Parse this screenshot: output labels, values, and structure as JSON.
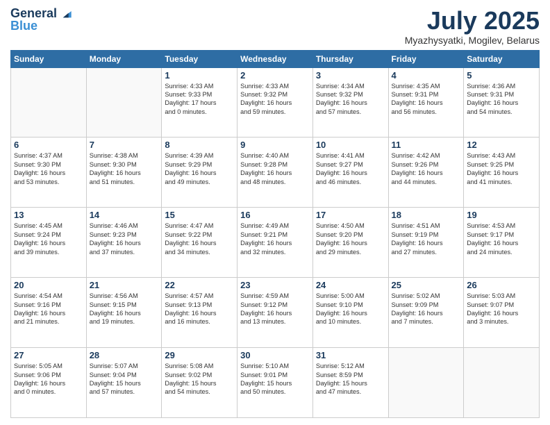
{
  "header": {
    "logo_line1": "General",
    "logo_line2": "Blue",
    "main_title": "July 2025",
    "subtitle": "Myazhysyatki, Mogilev, Belarus"
  },
  "days_of_week": [
    "Sunday",
    "Monday",
    "Tuesday",
    "Wednesday",
    "Thursday",
    "Friday",
    "Saturday"
  ],
  "weeks": [
    [
      {
        "day": "",
        "text": ""
      },
      {
        "day": "",
        "text": ""
      },
      {
        "day": "1",
        "text": "Sunrise: 4:33 AM\nSunset: 9:33 PM\nDaylight: 17 hours\nand 0 minutes."
      },
      {
        "day": "2",
        "text": "Sunrise: 4:33 AM\nSunset: 9:32 PM\nDaylight: 16 hours\nand 59 minutes."
      },
      {
        "day": "3",
        "text": "Sunrise: 4:34 AM\nSunset: 9:32 PM\nDaylight: 16 hours\nand 57 minutes."
      },
      {
        "day": "4",
        "text": "Sunrise: 4:35 AM\nSunset: 9:31 PM\nDaylight: 16 hours\nand 56 minutes."
      },
      {
        "day": "5",
        "text": "Sunrise: 4:36 AM\nSunset: 9:31 PM\nDaylight: 16 hours\nand 54 minutes."
      }
    ],
    [
      {
        "day": "6",
        "text": "Sunrise: 4:37 AM\nSunset: 9:30 PM\nDaylight: 16 hours\nand 53 minutes."
      },
      {
        "day": "7",
        "text": "Sunrise: 4:38 AM\nSunset: 9:30 PM\nDaylight: 16 hours\nand 51 minutes."
      },
      {
        "day": "8",
        "text": "Sunrise: 4:39 AM\nSunset: 9:29 PM\nDaylight: 16 hours\nand 49 minutes."
      },
      {
        "day": "9",
        "text": "Sunrise: 4:40 AM\nSunset: 9:28 PM\nDaylight: 16 hours\nand 48 minutes."
      },
      {
        "day": "10",
        "text": "Sunrise: 4:41 AM\nSunset: 9:27 PM\nDaylight: 16 hours\nand 46 minutes."
      },
      {
        "day": "11",
        "text": "Sunrise: 4:42 AM\nSunset: 9:26 PM\nDaylight: 16 hours\nand 44 minutes."
      },
      {
        "day": "12",
        "text": "Sunrise: 4:43 AM\nSunset: 9:25 PM\nDaylight: 16 hours\nand 41 minutes."
      }
    ],
    [
      {
        "day": "13",
        "text": "Sunrise: 4:45 AM\nSunset: 9:24 PM\nDaylight: 16 hours\nand 39 minutes."
      },
      {
        "day": "14",
        "text": "Sunrise: 4:46 AM\nSunset: 9:23 PM\nDaylight: 16 hours\nand 37 minutes."
      },
      {
        "day": "15",
        "text": "Sunrise: 4:47 AM\nSunset: 9:22 PM\nDaylight: 16 hours\nand 34 minutes."
      },
      {
        "day": "16",
        "text": "Sunrise: 4:49 AM\nSunset: 9:21 PM\nDaylight: 16 hours\nand 32 minutes."
      },
      {
        "day": "17",
        "text": "Sunrise: 4:50 AM\nSunset: 9:20 PM\nDaylight: 16 hours\nand 29 minutes."
      },
      {
        "day": "18",
        "text": "Sunrise: 4:51 AM\nSunset: 9:19 PM\nDaylight: 16 hours\nand 27 minutes."
      },
      {
        "day": "19",
        "text": "Sunrise: 4:53 AM\nSunset: 9:17 PM\nDaylight: 16 hours\nand 24 minutes."
      }
    ],
    [
      {
        "day": "20",
        "text": "Sunrise: 4:54 AM\nSunset: 9:16 PM\nDaylight: 16 hours\nand 21 minutes."
      },
      {
        "day": "21",
        "text": "Sunrise: 4:56 AM\nSunset: 9:15 PM\nDaylight: 16 hours\nand 19 minutes."
      },
      {
        "day": "22",
        "text": "Sunrise: 4:57 AM\nSunset: 9:13 PM\nDaylight: 16 hours\nand 16 minutes."
      },
      {
        "day": "23",
        "text": "Sunrise: 4:59 AM\nSunset: 9:12 PM\nDaylight: 16 hours\nand 13 minutes."
      },
      {
        "day": "24",
        "text": "Sunrise: 5:00 AM\nSunset: 9:10 PM\nDaylight: 16 hours\nand 10 minutes."
      },
      {
        "day": "25",
        "text": "Sunrise: 5:02 AM\nSunset: 9:09 PM\nDaylight: 16 hours\nand 7 minutes."
      },
      {
        "day": "26",
        "text": "Sunrise: 5:03 AM\nSunset: 9:07 PM\nDaylight: 16 hours\nand 3 minutes."
      }
    ],
    [
      {
        "day": "27",
        "text": "Sunrise: 5:05 AM\nSunset: 9:06 PM\nDaylight: 16 hours\nand 0 minutes."
      },
      {
        "day": "28",
        "text": "Sunrise: 5:07 AM\nSunset: 9:04 PM\nDaylight: 15 hours\nand 57 minutes."
      },
      {
        "day": "29",
        "text": "Sunrise: 5:08 AM\nSunset: 9:02 PM\nDaylight: 15 hours\nand 54 minutes."
      },
      {
        "day": "30",
        "text": "Sunrise: 5:10 AM\nSunset: 9:01 PM\nDaylight: 15 hours\nand 50 minutes."
      },
      {
        "day": "31",
        "text": "Sunrise: 5:12 AM\nSunset: 8:59 PM\nDaylight: 15 hours\nand 47 minutes."
      },
      {
        "day": "",
        "text": ""
      },
      {
        "day": "",
        "text": ""
      }
    ]
  ]
}
